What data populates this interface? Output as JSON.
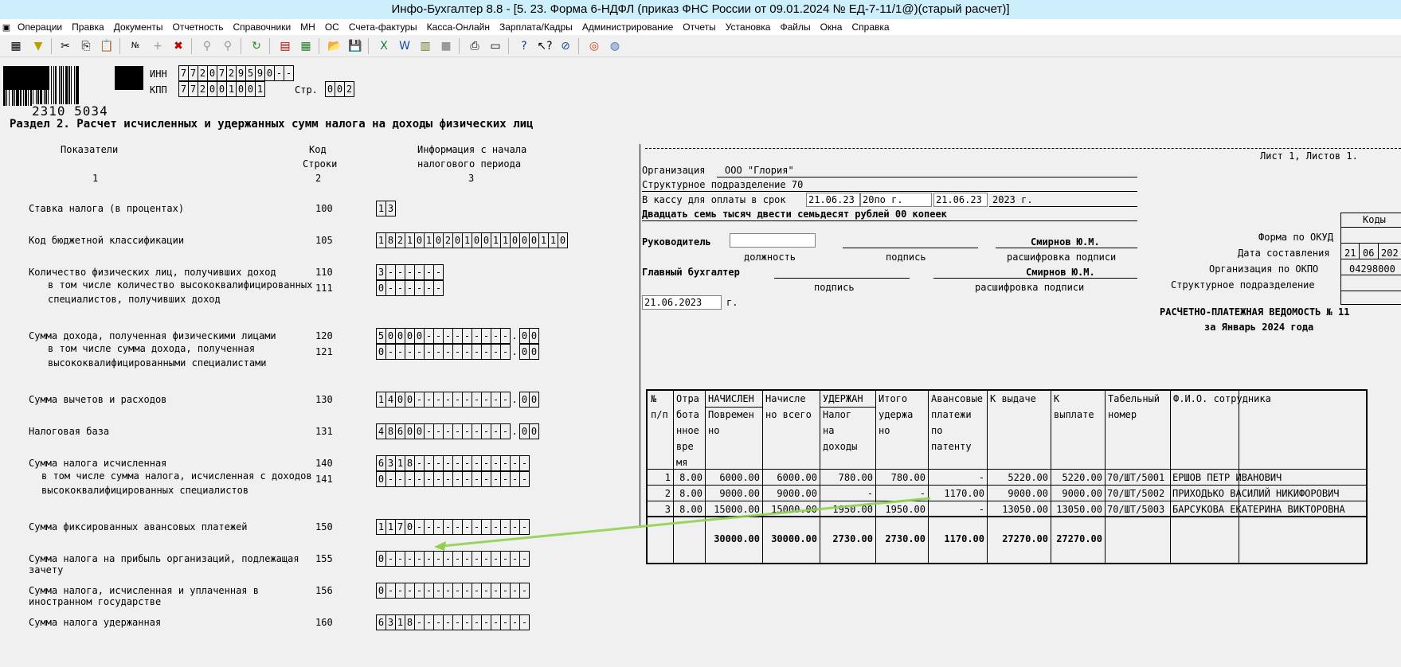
{
  "window": {
    "title": "Инфо-Бухгалтер 8.8 - [5. 23. Форма 6-НДФЛ (приказ ФНС России от 09.01.2024 № ЕД-7-11/1@)(старый расчет)]"
  },
  "menu": [
    "Операции",
    "Правка",
    "Документы",
    "Отчетность",
    "Справочники",
    "МН",
    "ОС",
    "Счета-фактуры",
    "Касса-Онлайн",
    "Зарплата/Кадры",
    "Администрирование",
    "Отчеты",
    "Установка",
    "Файлы",
    "Окна",
    "Справка"
  ],
  "header": {
    "barcode_number": "2310 5034",
    "inn_label": "ИНН",
    "inn_cells": [
      "7",
      "7",
      "2",
      "0",
      "7",
      "2",
      "9",
      "5",
      "9",
      "0",
      "-",
      "-"
    ],
    "kpp_label": "КПП",
    "kpp_cells": [
      "7",
      "7",
      "2",
      "0",
      "0",
      "1",
      "0",
      "0",
      "1"
    ],
    "page_label": "Стр.",
    "page_cells": [
      "0",
      "0",
      "2"
    ]
  },
  "section": {
    "title": "Раздел 2. Расчет исчисленных и удержанных сумм налога на доходы физических лиц",
    "col_indicators": "Показатели",
    "col_code_1": "Код",
    "col_code_2": "Строки",
    "col_info_1": "Информация с начала",
    "col_info_2": "налогового периода",
    "col_num_1": "1",
    "col_num_2": "2",
    "col_num_3": "3"
  },
  "rows": [
    {
      "lines": [
        "Ставка налога (в процентах)"
      ],
      "code": "100",
      "cells": [
        "1",
        "3"
      ]
    },
    {
      "lines": [
        "Код бюджетной классификации"
      ],
      "code": "105",
      "cells": [
        "1",
        "8",
        "2",
        "1",
        "0",
        "1",
        "0",
        "2",
        "0",
        "1",
        "0",
        "0",
        "1",
        "1",
        "0",
        "0",
        "0",
        "1",
        "1",
        "0"
      ]
    },
    {
      "lines": [
        "Количество физических лиц, получивших доход"
      ],
      "code": "110",
      "cells": [
        "3",
        "-",
        "-",
        "-",
        "-",
        "-",
        "-"
      ]
    },
    {
      "lines": [
        "в том числе количество высококвалифицированных",
        "специалистов, получивших доход"
      ],
      "code": "111",
      "cells": [
        "0",
        "-",
        "-",
        "-",
        "-",
        "-",
        "-"
      ]
    },
    {
      "lines": [
        "Сумма дохода, полученная физическими лицами"
      ],
      "code": "120",
      "cells": [
        "5",
        "0",
        "0",
        "0",
        "0",
        "-",
        "-",
        "-",
        "-",
        "-",
        "-",
        "-",
        "-",
        "-"
      ],
      "dec": [
        "0",
        "0"
      ]
    },
    {
      "lines": [
        "в том числе сумма дохода, полученная",
        "высококвалифицированными специалистами"
      ],
      "code": "121",
      "cells": [
        "0",
        "-",
        "-",
        "-",
        "-",
        "-",
        "-",
        "-",
        "-",
        "-",
        "-",
        "-",
        "-",
        "-"
      ],
      "dec": [
        "0",
        "0"
      ]
    },
    {
      "lines": [
        "Сумма вычетов и расходов"
      ],
      "code": "130",
      "cells": [
        "1",
        "4",
        "0",
        "0",
        "-",
        "-",
        "-",
        "-",
        "-",
        "-",
        "-",
        "-",
        "-",
        "-"
      ],
      "dec": [
        "0",
        "0"
      ]
    },
    {
      "lines": [
        "Налоговая база"
      ],
      "code": "131",
      "cells": [
        "4",
        "8",
        "6",
        "0",
        "0",
        "-",
        "-",
        "-",
        "-",
        "-",
        "-",
        "-",
        "-",
        "-"
      ],
      "dec": [
        "0",
        "0"
      ]
    },
    {
      "lines": [
        "Сумма налога исчисленная"
      ],
      "code": "140",
      "cells": [
        "6",
        "3",
        "1",
        "8",
        "-",
        "-",
        "-",
        "-",
        "-",
        "-",
        "-",
        "-",
        "-",
        "-",
        "-",
        "-"
      ]
    },
    {
      "lines": [
        "в том числе сумма налога, исчисленная с доходов",
        "высококвалифицированных специалистов"
      ],
      "code": "141",
      "cells": [
        "0",
        "-",
        "-",
        "-",
        "-",
        "-",
        "-",
        "-",
        "-",
        "-",
        "-",
        "-",
        "-",
        "-",
        "-",
        "-"
      ]
    },
    {
      "lines": [
        "Сумма фиксированных авансовых платежей"
      ],
      "code": "150",
      "cells": [
        "1",
        "1",
        "7",
        "0",
        "-",
        "-",
        "-",
        "-",
        "-",
        "-",
        "-",
        "-",
        "-",
        "-",
        "-",
        "-"
      ]
    },
    {
      "lines": [
        "Сумма налога на прибыль организаций, подлежащая",
        "зачету"
      ],
      "code": "155",
      "cells": [
        "0",
        "-",
        "-",
        "-",
        "-",
        "-",
        "-",
        "-",
        "-",
        "-",
        "-",
        "-",
        "-",
        "-",
        "-",
        "-"
      ]
    },
    {
      "lines": [
        "Сумма налога, исчисленная и уплаченная в",
        "иностранном государстве"
      ],
      "code": "156",
      "cells": [
        "0",
        "-",
        "-",
        "-",
        "-",
        "-",
        "-",
        "-",
        "-",
        "-",
        "-",
        "-",
        "-",
        "-",
        "-",
        "-"
      ]
    },
    {
      "lines": [
        "Сумма налога удержанная"
      ],
      "code": "160",
      "cells": [
        "6",
        "3",
        "1",
        "8",
        "-",
        "-",
        "-",
        "-",
        "-",
        "-",
        "-",
        "-",
        "-",
        "-",
        "-",
        "-"
      ]
    }
  ],
  "vedomost": {
    "sheet_info": "Лист 1, Листов 1.",
    "org_label": "Организация",
    "org_name": "ООО \"Глория\"",
    "subdiv": "Структурное подразделение 70",
    "cash_label": "В кассу для оплаты в срок",
    "cash_from": "21.06.23",
    "cash_mid": "20",
    "cash_po": "по",
    "cash_g": "г.",
    "cash_to": "21.06.23",
    "cash_end": "2023 г.",
    "amount_words": "Двадцать семь тысяч двести семьдесят рублей 00 копеек",
    "head_label": "Руководитель",
    "head_name": "Смирнов Ю.М.",
    "sub_position": "должность",
    "sub_signature": "подпись",
    "sub_decode": "расшифровка подписи",
    "chief_label": "Главный бухгалтер",
    "chief_name": "Смирнов Ю.М.",
    "sub_signature2": "подпись",
    "sub_decode2": "расшифровка подписи",
    "date": "21.06.2023",
    "date_suffix": "г.",
    "codes_header": "Коды",
    "okud_label": "Форма по ОКУД",
    "date_comp_label": "Дата составления",
    "date_comp": [
      "21",
      "06",
      "202"
    ],
    "okpo_label": "Организация по ОКПО",
    "okpo": "04298000",
    "struct_label": "Структурное подразделение",
    "doc_title": "РАСЧЕТНО-ПЛАТЕЖНАЯ ВЕДОМОСТЬ № 11",
    "doc_period": "за Январь 2024 года",
    "columns": {
      "num": [
        "№",
        "п/п"
      ],
      "worked": [
        "Отра",
        "бота",
        "нное",
        "вре",
        "мя"
      ],
      "accrued_group": "НАЧИСЛЕН",
      "accrued_time": [
        "Повремен",
        "но"
      ],
      "accrued_total": [
        "Начисле",
        "но всего"
      ],
      "withheld_group": "УДЕРЖАН",
      "withheld_tax": [
        "Налог",
        "на",
        "доходы"
      ],
      "withheld_total": [
        "Итого",
        "удержа",
        "но"
      ],
      "advance": [
        "Авансовые",
        "платежи",
        "по",
        "патенту"
      ],
      "to_issue": "К выдаче",
      "to_pay": [
        "К",
        "выплате"
      ],
      "tab_num": [
        "Табельный",
        "номер"
      ],
      "fio": "Ф.И.О. сотрудника"
    },
    "rows": [
      {
        "n": "1",
        "worked": "8.00",
        "time": "6000.00",
        "total": "6000.00",
        "tax": "780.00",
        "withheld": "780.00",
        "advance": "-",
        "issue": "5220.00",
        "pay": "5220.00",
        "tab": "70/ШТ/5001",
        "fio": "ЕРШОВ ПЕТР ИВАНОВИЧ"
      },
      {
        "n": "2",
        "worked": "8.00",
        "time": "9000.00",
        "total": "9000.00",
        "tax": "-",
        "withheld": "-",
        "advance": "1170.00",
        "issue": "9000.00",
        "pay": "9000.00",
        "tab": "70/ШТ/5002",
        "fio": "ПРИХОДЬКО ВАСИЛИЙ НИКИФОРОВИЧ"
      },
      {
        "n": "3",
        "worked": "8.00",
        "time": "15000.00",
        "total": "15000.00",
        "tax": "1950.00",
        "withheld": "1950.00",
        "advance": "-",
        "issue": "13050.00",
        "pay": "13050.00",
        "tab": "70/ШТ/5003",
        "fio": "БАРСУКОВА ЕКАТЕРИНА ВИКТОРОВНА"
      }
    ],
    "totals": {
      "time": "30000.00",
      "total": "30000.00",
      "tax": "2730.00",
      "withheld": "2730.00",
      "advance": "1170.00",
      "issue": "27270.00",
      "pay": "27270.00"
    }
  },
  "colors": {
    "titlebar": "#cdeefb",
    "arrow": "#8fd14f"
  }
}
